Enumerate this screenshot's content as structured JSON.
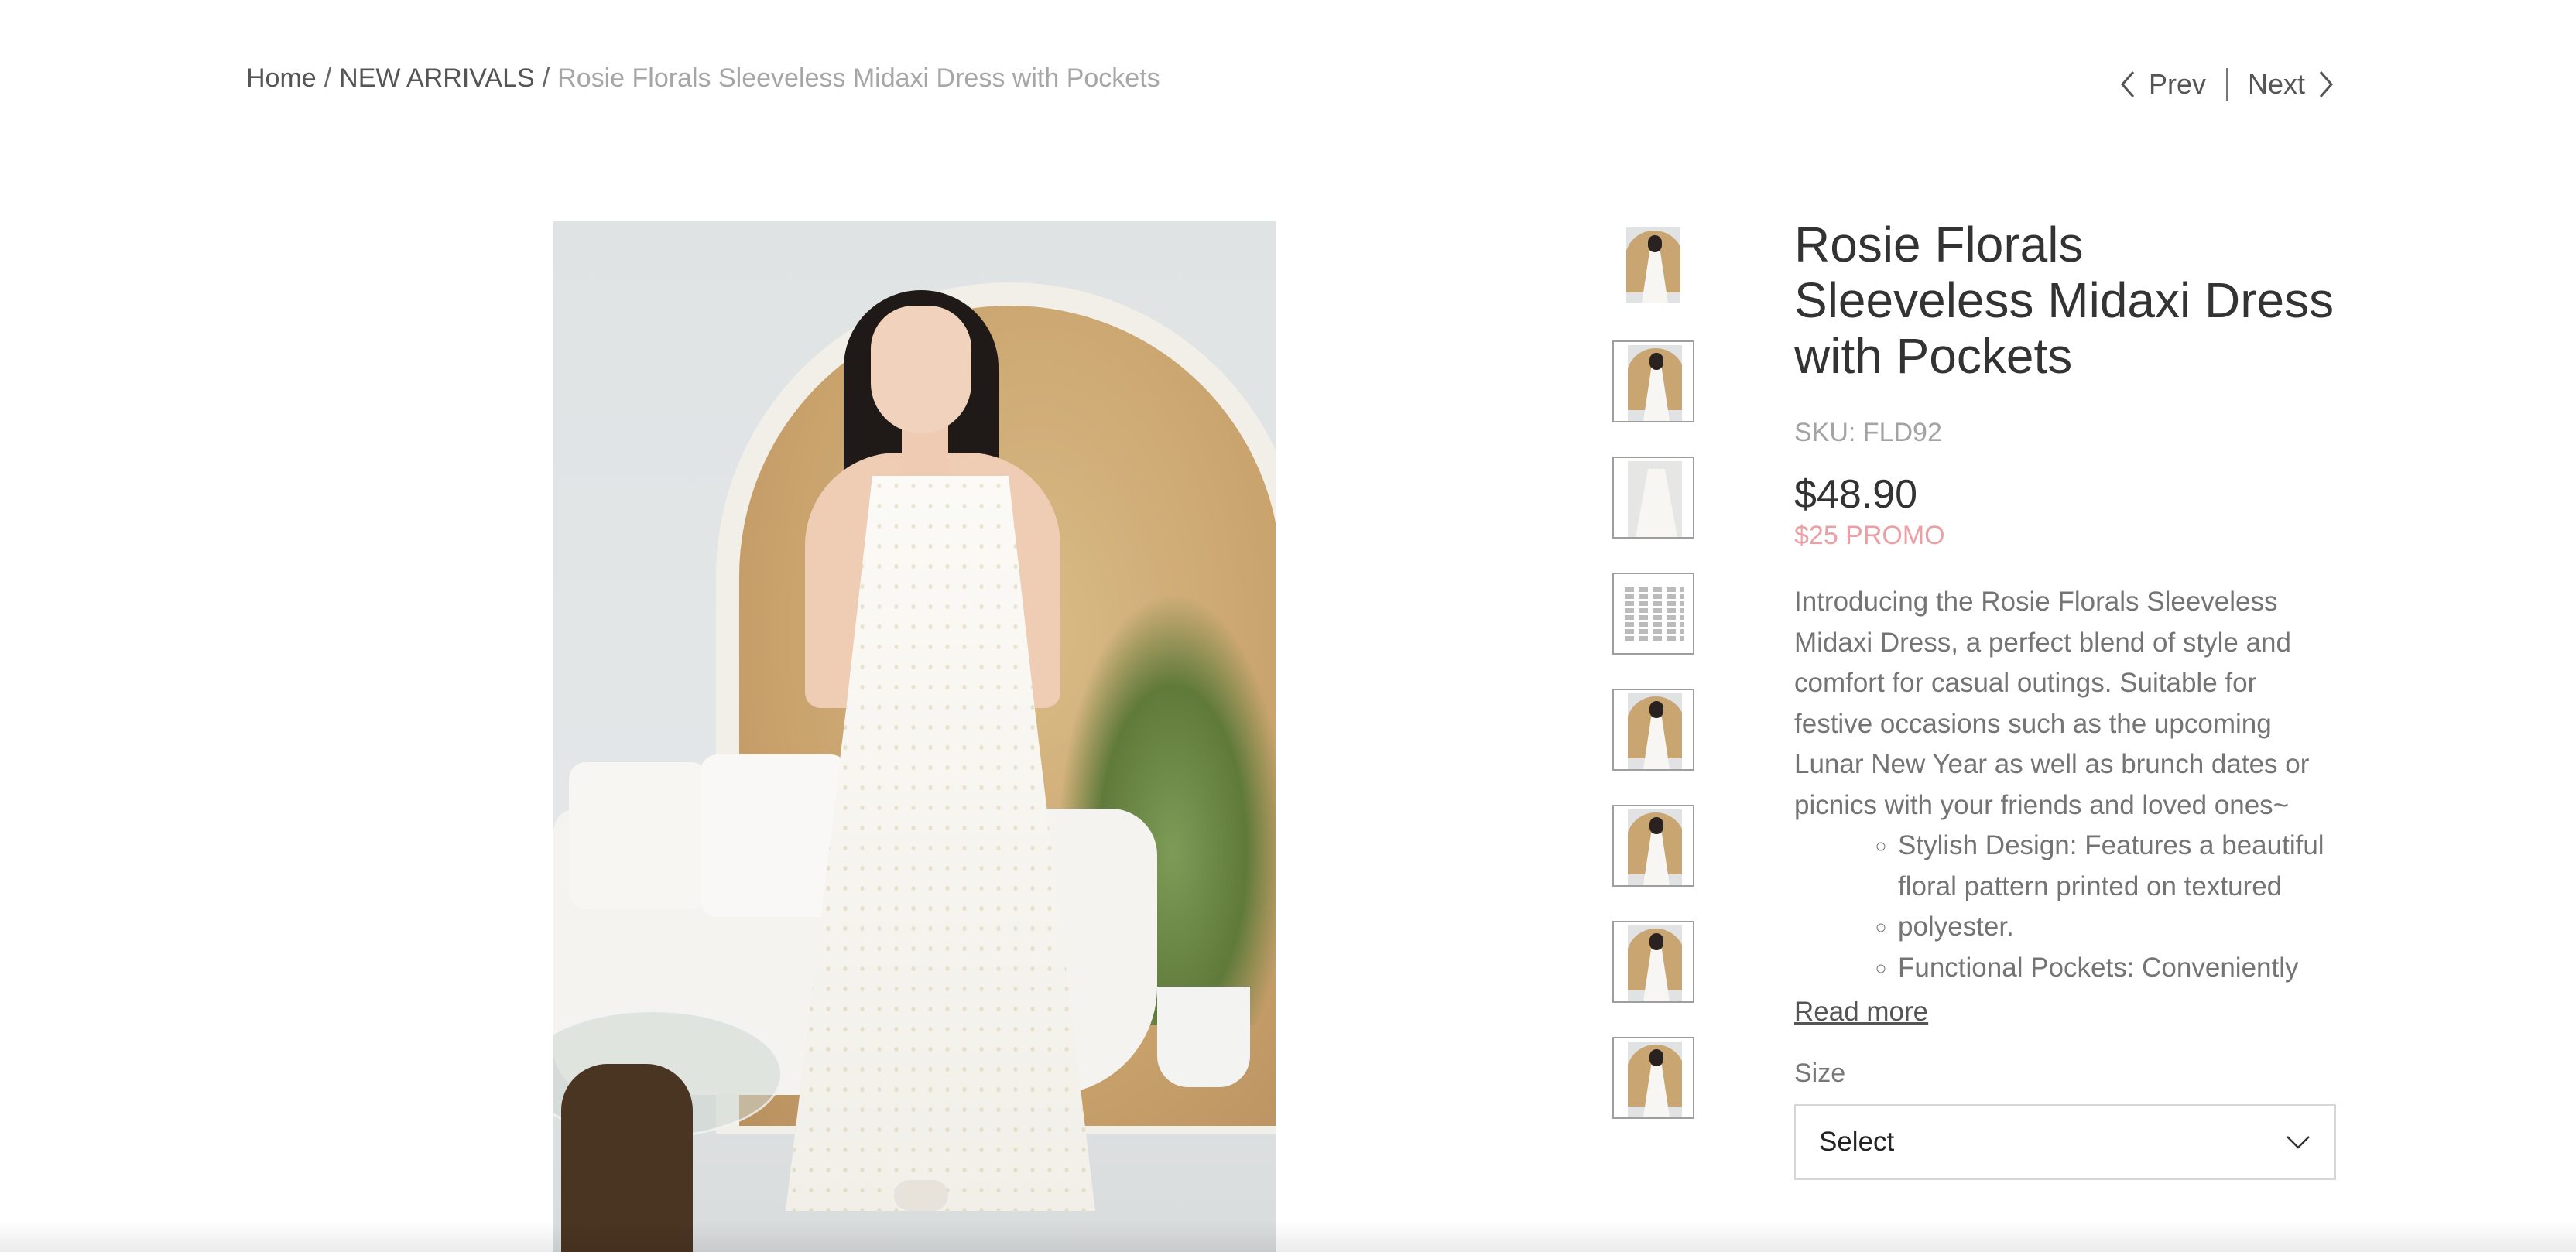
{
  "breadcrumb": {
    "home": "Home",
    "category": "NEW ARRIVALS",
    "current": "Rosie Florals Sleeveless Midaxi Dress with Pockets",
    "separator": "/"
  },
  "pager": {
    "prev": "Prev",
    "next": "Next"
  },
  "product": {
    "title": "Rosie Florals Sleeveless Midaxi Dress with Pockets",
    "sku": "SKU: FLD92",
    "price": "$48.90",
    "promo": "$25 PROMO",
    "description": "Introducing the Rosie Florals Sleeveless Midaxi Dress, a perfect blend of style and comfort for casual outings. Suitable for festive occasions such as the upcoming Lunar New Year as well as brunch dates or picnics with your friends and loved ones~",
    "bullets": [
      "Stylish Design: Features a beautiful floral pattern printed on textured",
      "polyester.",
      "Functional Pockets: Conveniently"
    ],
    "read_more": "Read more",
    "size_label": "Size",
    "size_selected": "Select"
  },
  "colors": {
    "promo": "#eaa0a4",
    "text": "#333333",
    "muted": "#a3a3a3"
  }
}
